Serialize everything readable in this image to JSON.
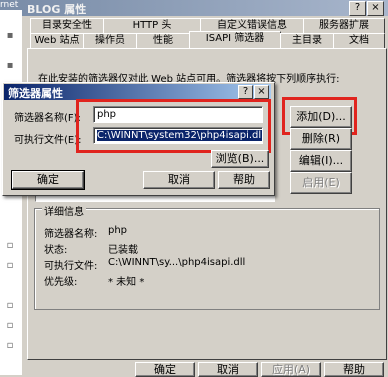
{
  "background_window": {
    "title_fragment": "rnet"
  },
  "dialog": {
    "title": "BLOG 属性",
    "help_button": "?",
    "close_button": "×",
    "tabs_row1": [
      "目录安全性",
      "HTTP 头",
      "自定义错误信息",
      "服务器扩展"
    ],
    "tabs_row2": [
      "Web 站点",
      "操作员",
      "性能",
      "ISAPI 筛选器",
      "主目录",
      "文档"
    ],
    "active_tab": "ISAPI 筛选器",
    "intro_text": "在此安装的筛选器仅对此 Web 站点可用。筛选器将按下列顺序执行:",
    "side_buttons": {
      "add": "添加(D)...",
      "remove": "删除(R)",
      "edit": "编辑(I)...",
      "enable": "启用(E)"
    },
    "details": {
      "group_label": "详细信息",
      "rows": [
        {
          "label": "筛选器名称:",
          "value": "php"
        },
        {
          "label": "状态:",
          "value": "已装载"
        },
        {
          "label": "可执行文件:",
          "value": "C:\\WINNT\\sy...\\php4isapi.dll"
        },
        {
          "label": "优先级:",
          "value": "* 未知 *"
        }
      ]
    },
    "bottom_buttons": {
      "ok": "确定",
      "cancel": "取消",
      "apply": "应用(A)",
      "help": "帮助"
    }
  },
  "modal": {
    "title": "筛选器属性",
    "help_button": "?",
    "close_button": "×",
    "name_label": "筛选器名称(F):",
    "name_value": "php",
    "exe_label": "可执行文件(E):",
    "exe_value": "C:\\WINNT\\system32\\php4isapi.dll",
    "browse_button": "浏览(B)...",
    "ok_button": "确定",
    "cancel_button": "取消",
    "help_button_text": "帮助"
  },
  "colors": {
    "highlight_box": "#e0241e",
    "dialog_face": "#d4d0c8",
    "modal_title": "#0a246a"
  }
}
